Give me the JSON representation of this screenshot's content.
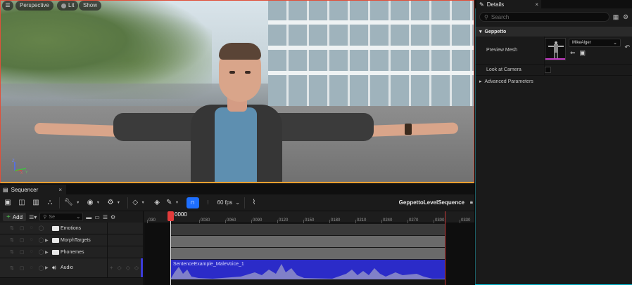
{
  "viewport": {
    "menu_icon": "hamburger-icon",
    "perspective_label": "Perspective",
    "lit_label": "Lit",
    "show_label": "Show",
    "axis_labels": {
      "z": "Z",
      "x": "X",
      "y": "Y"
    }
  },
  "details": {
    "tab_label": "Details",
    "tab_icon": "pencil-icon",
    "close_glyph": "×",
    "search_placeholder": "Search",
    "category": "Geppetto",
    "preview_mesh_label": "Preview Mesh",
    "preview_mesh_value": "MikeAlger",
    "look_at_camera_label": "Look at Camera",
    "look_at_camera_checked": false,
    "advanced_label": "Advanced Parameters"
  },
  "sequencer": {
    "tab_label": "Sequencer",
    "close_glyph": "×",
    "fps_label": "60 fps",
    "sequence_name": "GeppettoLevelSequence",
    "add_label": "Add",
    "search_value": "Se",
    "current_time": "0000",
    "ruler_ticks": [
      "030",
      "0000",
      "0030",
      "0060",
      "0090",
      "0120",
      "0150",
      "0180",
      "0210",
      "0240",
      "0270",
      "0300",
      "0330"
    ],
    "tracks": [
      {
        "label": "Emotions",
        "type": "folder",
        "expandable": false
      },
      {
        "label": "MorphTargets",
        "type": "folder",
        "expandable": true
      },
      {
        "label": "Phonemes",
        "type": "folder",
        "expandable": true
      },
      {
        "label": "Audio",
        "type": "audio",
        "expandable": true
      }
    ],
    "audio_clip_label": "SentenceExample_MaleVoice_1",
    "colors": {
      "snap_active": "#1e6fff",
      "audio_clip": "#2b2bc8",
      "playhead": "#e23b3b",
      "details_border": "#00bcd4"
    }
  }
}
